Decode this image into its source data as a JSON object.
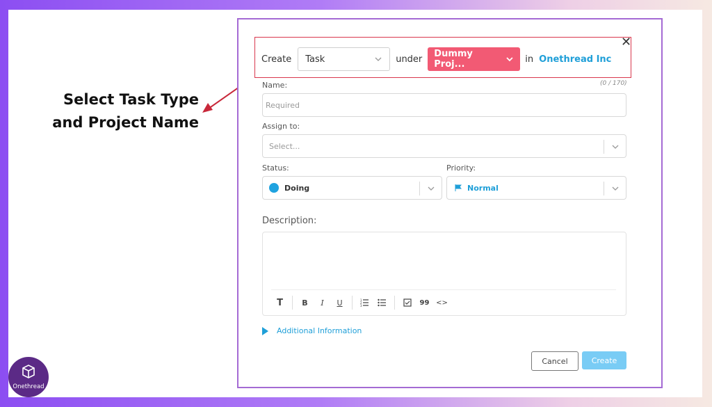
{
  "annotation": {
    "line1": "Select Task Type",
    "line2": "and Project Name"
  },
  "logo": {
    "text": "Onethread",
    "icon": "box-logo-icon"
  },
  "modal": {
    "close_glyph": "✕",
    "header": {
      "create_text": "Create",
      "task_type_value": "Task",
      "under_text": "under",
      "project_value": "Dummy Proj...",
      "in_text": "in",
      "org_link": "Onethread Inc"
    },
    "name": {
      "label": "Name:",
      "counter": "(0 / 170)",
      "placeholder": "Required"
    },
    "assign": {
      "label": "Assign to:",
      "placeholder": "Select..."
    },
    "status": {
      "label": "Status:",
      "value": "Doing"
    },
    "priority": {
      "label": "Priority:",
      "value": "Normal"
    },
    "description": {
      "label": "Description:",
      "toolbar": {
        "text_style": "T",
        "bold": "B",
        "italic": "I",
        "underline": "U",
        "blockquote": "99",
        "code": "<>"
      }
    },
    "additional_info": "Additional Information",
    "cancel_label": "Cancel",
    "create_label": "Create"
  },
  "colors": {
    "accent": "#1f9fd8",
    "project_pill": "#f25a74",
    "highlight": "#d9364c",
    "modal_border": "#a46ad4",
    "create_button": "#79ccf5",
    "logo_bg": "#5b2a86"
  }
}
